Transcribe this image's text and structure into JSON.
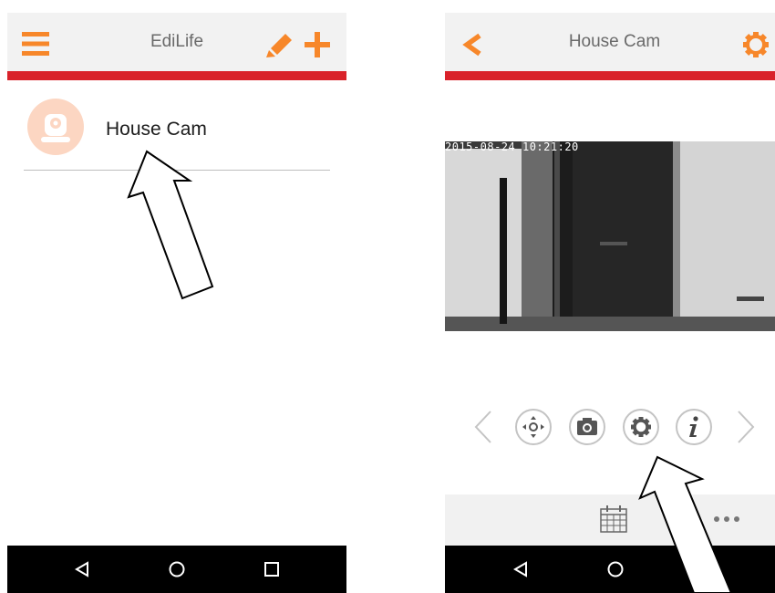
{
  "left_screen": {
    "app_title": "EdiLife",
    "list_items": [
      {
        "label": "House Cam"
      }
    ]
  },
  "right_screen": {
    "title": "House Cam",
    "camera": {
      "timestamp": "2015-08-24 10:21:20"
    },
    "controls": [
      "arrow-left-icon",
      "ptz-move-icon",
      "snapshot-camera-icon",
      "settings-gear-icon",
      "info-icon",
      "arrow-right-icon"
    ],
    "bottom_actions": [
      "calendar-icon",
      "more-dots-icon"
    ]
  },
  "colors": {
    "accent_orange": "#f7872a",
    "red_strip": "#d9222a",
    "appbar_bg": "#f2f2f2",
    "navbar_bg": "#000000"
  }
}
